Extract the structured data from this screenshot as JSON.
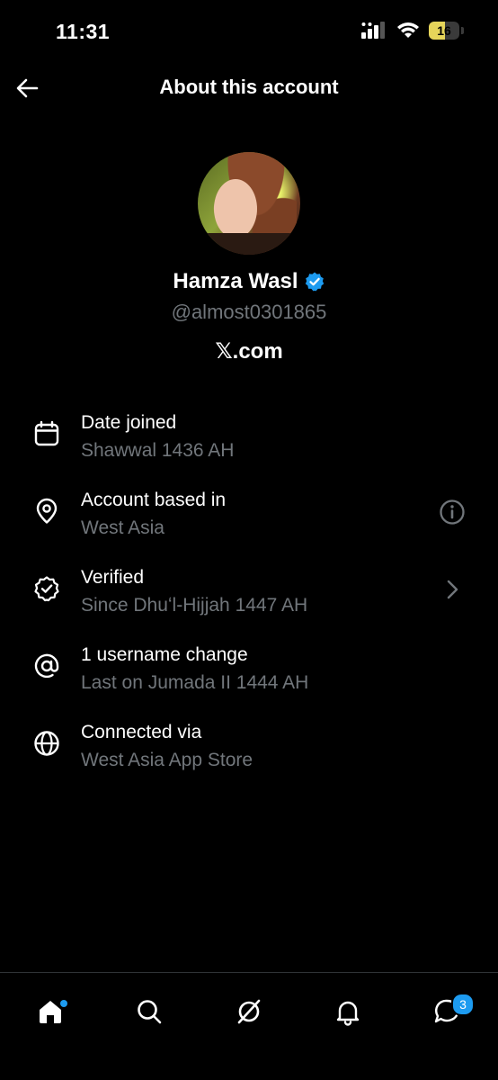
{
  "status_bar": {
    "time": "11:31",
    "battery_level": "16",
    "battery_fraction": 0.16
  },
  "header": {
    "title": "About this account"
  },
  "profile": {
    "display_name": "Hamza Wasl",
    "handle": "@almost0301865",
    "site_label": ".com",
    "site_logo_glyph": "𝕏"
  },
  "info_rows": [
    {
      "icon": "calendar-icon",
      "title": "Date joined",
      "subtitle": "Shawwal 1436 AH"
    },
    {
      "icon": "location-pin-icon",
      "title": "Account based in",
      "subtitle": "West Asia",
      "action_icon": "info-icon"
    },
    {
      "icon": "verified-badge-icon",
      "title": "Verified",
      "subtitle": "Since Dhuʻl-Hijjah 1447 AH",
      "action_icon": "chevron-right-icon"
    },
    {
      "icon": "at-sign-icon",
      "title": "1 username change",
      "subtitle": "Last on Jumada II 1444 AH"
    },
    {
      "icon": "globe-icon",
      "title": "Connected via",
      "subtitle": "West Asia App Store"
    }
  ],
  "bottom_nav": {
    "items": [
      "home-icon",
      "search-icon",
      "grok-icon",
      "bell-icon",
      "messages-icon"
    ],
    "messages_badge": "3"
  },
  "colors": {
    "background": "#000000",
    "text_primary": "#ffffff",
    "text_secondary": "#71767b",
    "accent": "#1d9bf0",
    "battery": "#e6d55a"
  }
}
